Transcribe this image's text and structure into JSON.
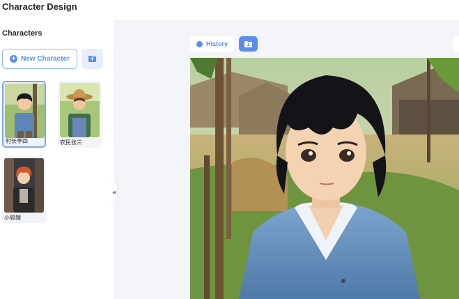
{
  "header": {
    "title": "Character Design"
  },
  "sidebar": {
    "title": "Characters",
    "new_character_label": "New Character",
    "characters": [
      {
        "name": "村长李四",
        "selected": true
      },
      {
        "name": "农民张三",
        "selected": false
      },
      {
        "name": "小狐狸",
        "selected": false
      }
    ]
  },
  "toolbar": {
    "history_label": "History"
  },
  "icons": {
    "new": "plus-circle-icon",
    "import": "folder-upload-icon",
    "history": "history-dot-icon",
    "save": "folder-save-icon",
    "collapse": "chevron-left-icon"
  },
  "colors": {
    "accent": "#5b8def",
    "accent_light": "#e6eefc",
    "main_bg": "#f2f4f7",
    "card_bg": "#f2f4f7"
  }
}
